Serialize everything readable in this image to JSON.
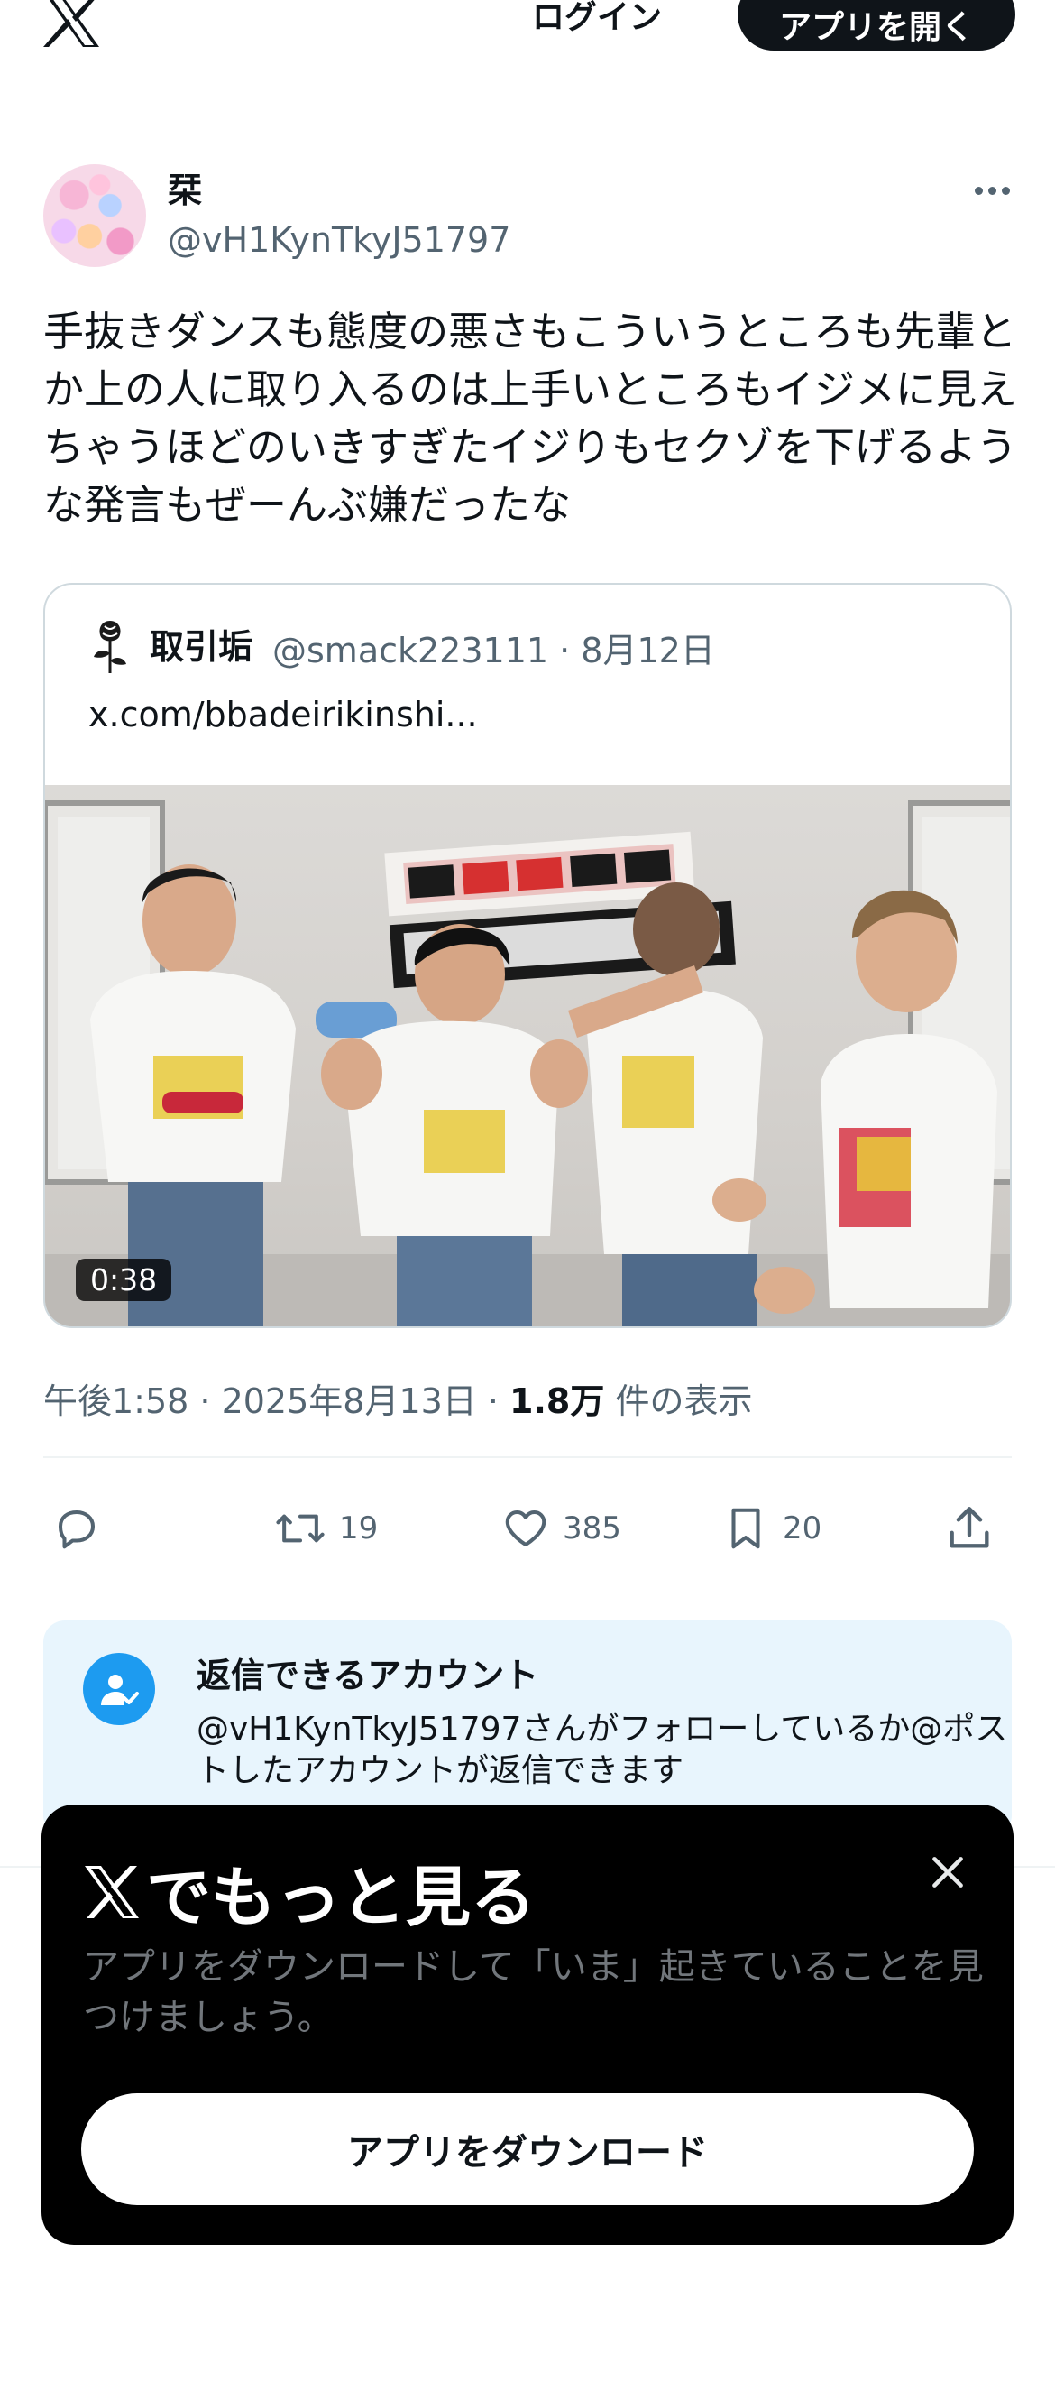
{
  "header": {
    "logo_icon": "x-logo-icon",
    "login_label": "ログイン",
    "open_app_label": "アプリを開く"
  },
  "post": {
    "display_name": "栞",
    "handle": "@vH1KynTkyJ51797",
    "text": "手抜きダンスも態度の悪さもこういうところも先輩とか上の人に取り入るのは上手いところもイジメに見えちゃうほどのいきすぎたイジりもセクゾを下げるような発言もぜーんぶ嫌だったな",
    "timestamp": "午後1:58 · 2025年8月13日 · ",
    "views_count": "1.8万",
    "views_label": " 件の表示"
  },
  "quote": {
    "display_name": "取引垢",
    "meta": "@smack223111 · 8月12日",
    "link_text": "x.com/bbadeirikinshi...",
    "video_duration": "0:38"
  },
  "actions": {
    "reply_icon": "reply-icon",
    "retweet_count": "19",
    "like_count": "385",
    "bookmark_count": "20",
    "share_icon": "share-icon"
  },
  "reply_notice": {
    "title": "返信できるアカウント",
    "description": "@vH1KynTkyJ51797さんがフォローしているか@ポストしたアカウントが返信できます"
  },
  "sheet": {
    "title": "でもっと見る",
    "description": "アプリをダウンロードして「いま」起きていることを見つけましょう。",
    "download_label": "アプリをダウンロード"
  },
  "colors": {
    "text_primary": "#0f1419",
    "text_secondary": "#536471",
    "accent_blue": "#1d9bf0",
    "notice_background": "#e8f5fd"
  }
}
